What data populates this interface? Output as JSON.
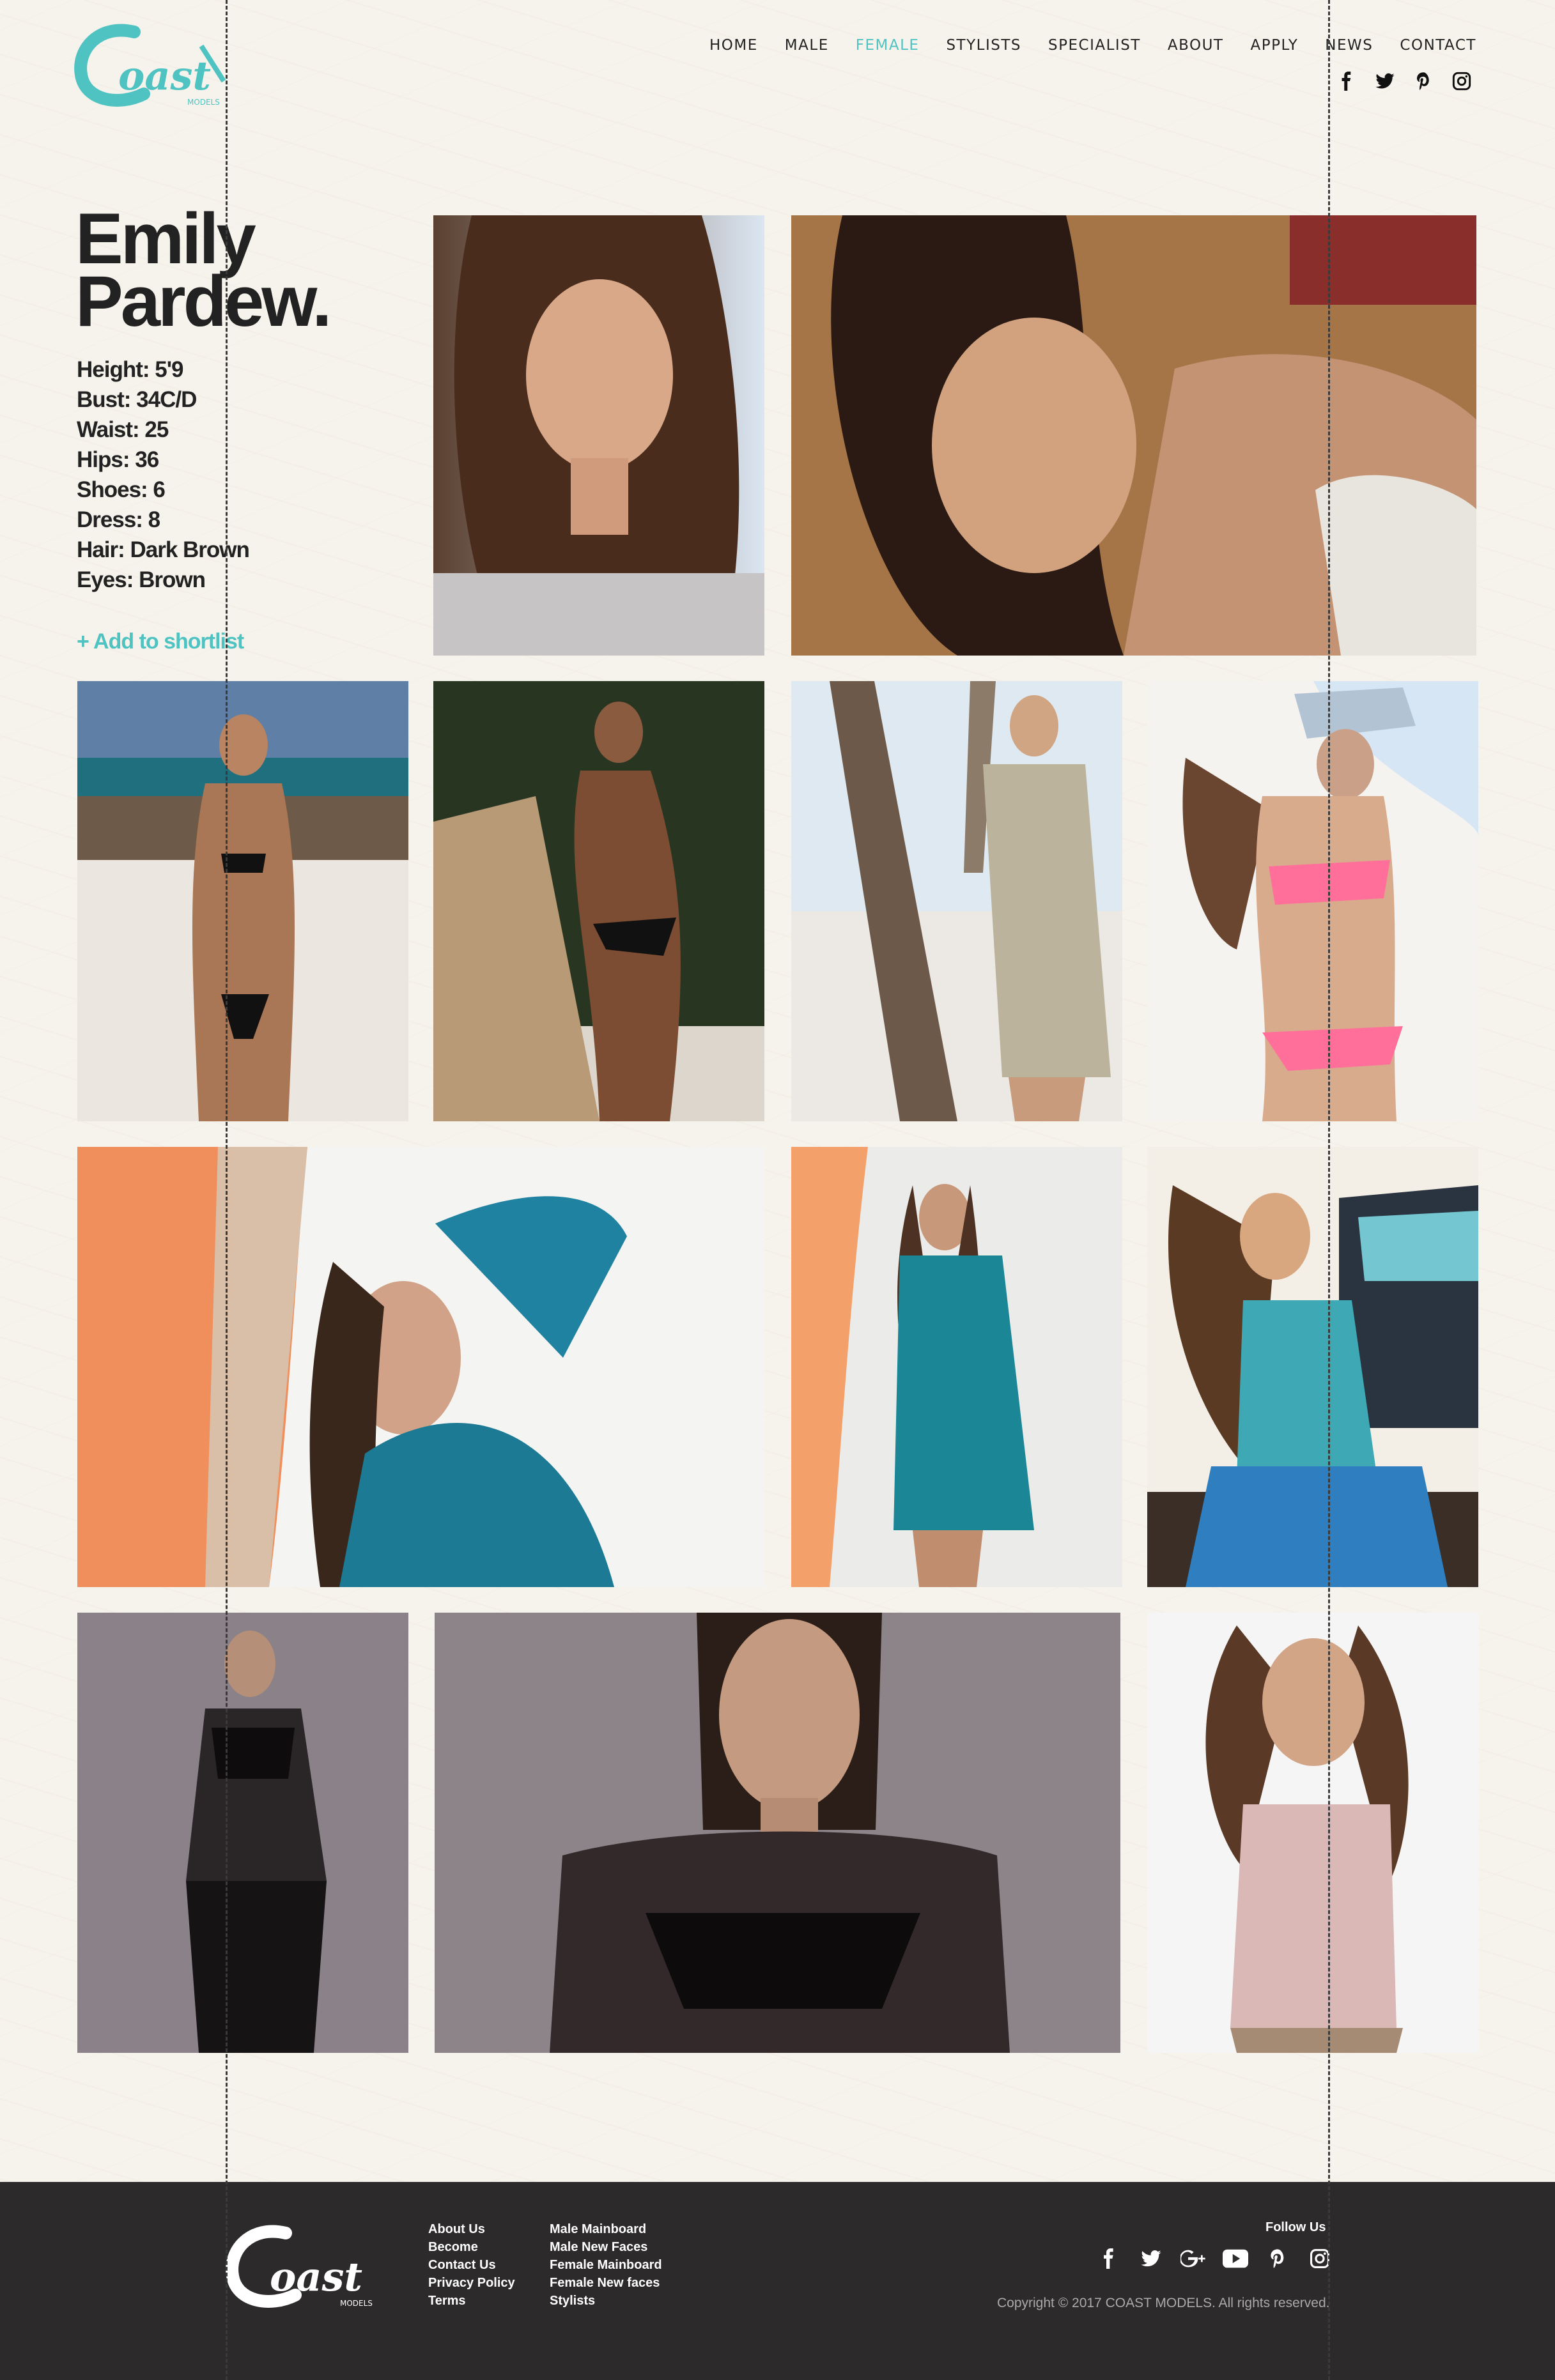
{
  "brand": {
    "logo_text": "Coast",
    "logo_sub": "MODELS",
    "accent_color": "#4ec3c2"
  },
  "nav": {
    "items": [
      "HOME",
      "MALE",
      "FEMALE",
      "STYLISTS",
      "SPECIALIST",
      "ABOUT",
      "APPLY",
      "NEWS",
      "CONTACT"
    ],
    "active": "FEMALE"
  },
  "social_top": [
    "facebook-icon",
    "twitter-icon",
    "pinterest-icon",
    "instagram-icon"
  ],
  "profile": {
    "first_name": "Emily",
    "last_name": "Pardew.",
    "stats": [
      "Height: 5'9",
      "Bust: 34C/D",
      "Waist: 25",
      "Hips: 36",
      "Shoes: 6",
      "Dress: 8",
      "Hair: Dark Brown",
      "Eyes: Brown"
    ],
    "shortlist_label": "+ Add to shortlist"
  },
  "photos": [
    "portrait-close-up",
    "lying-on-floor-portrait",
    "beach-bikini-sandy",
    "outdoor-shower-bikini",
    "tree-khaki-dress",
    "pink-bikini-hat",
    "teal-shirt-orange-wall",
    "teal-shirt-full-length",
    "teal-top-truck",
    "sheer-black-top-full",
    "sheer-black-top-portrait",
    "pink-tank-top"
  ],
  "footer": {
    "col1": [
      "About Us",
      "Become",
      "Contact Us",
      "Privacy Policy",
      "Terms"
    ],
    "col2": [
      "Male Mainboard",
      "Male New Faces",
      "Female Mainboard",
      "Female New faces",
      "Stylists"
    ],
    "follow_label": "Follow Us",
    "social": [
      "facebook-icon",
      "twitter-icon",
      "google-plus-icon",
      "youtube-icon",
      "pinterest-icon",
      "instagram-icon"
    ],
    "copyright": "Copyright © 2017 COAST MODELS. All rights reserved."
  }
}
